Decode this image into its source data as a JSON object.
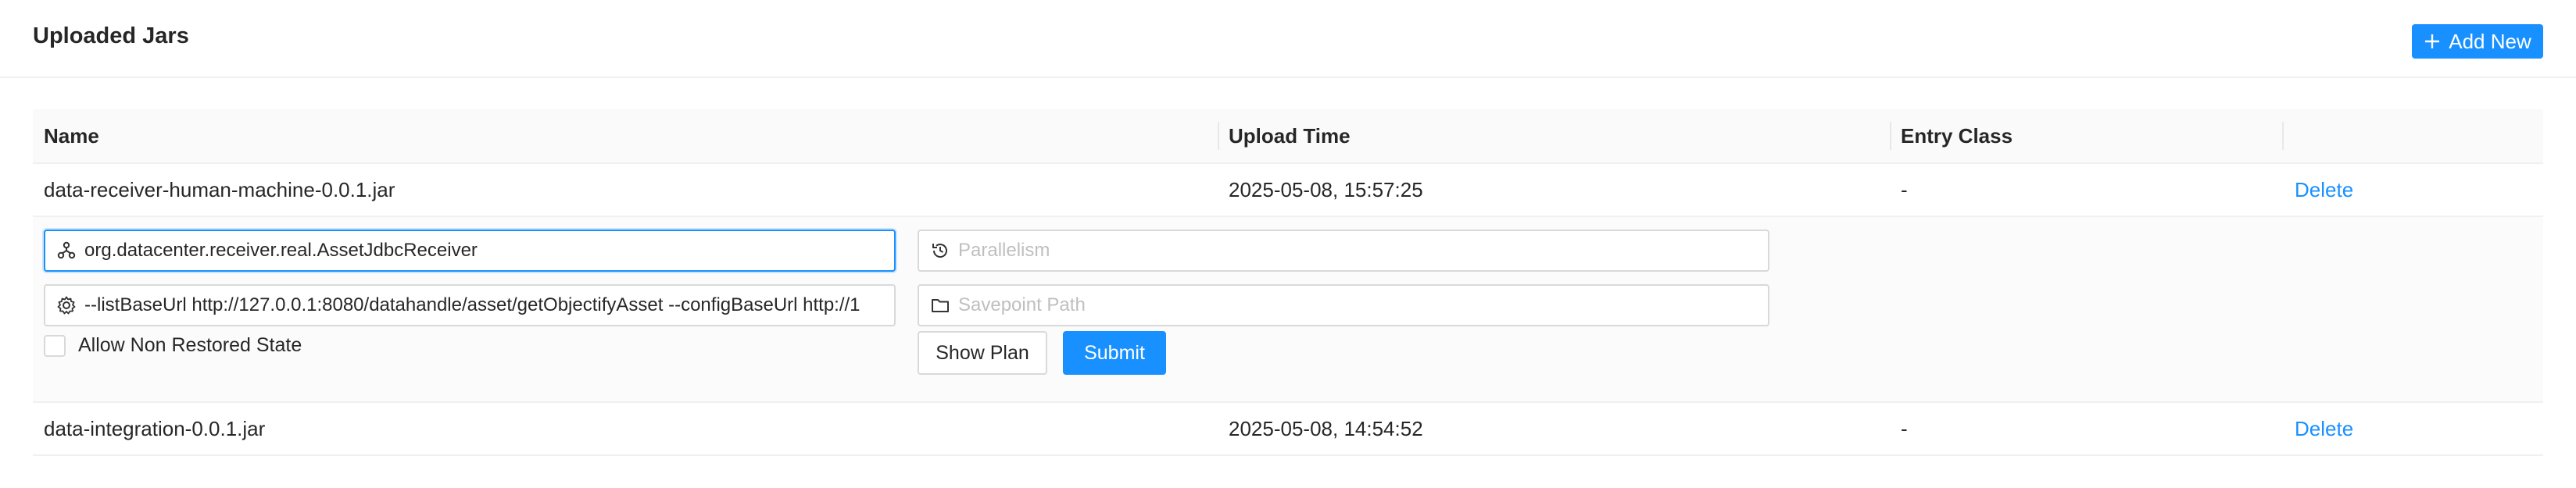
{
  "header": {
    "title": "Uploaded Jars",
    "add_label": "Add New"
  },
  "table": {
    "columns": [
      "Name",
      "Upload Time",
      "Entry Class",
      ""
    ],
    "rows": [
      {
        "name": "data-receiver-human-machine-0.0.1.jar",
        "upload_time": "2025-05-08, 15:57:25",
        "entry_class": "-",
        "action": "Delete"
      },
      {
        "name": "data-integration-0.0.1.jar",
        "upload_time": "2025-05-08, 14:54:52",
        "entry_class": "-",
        "action": "Delete"
      }
    ]
  },
  "submit_form": {
    "entry_class_value": "org.datacenter.receiver.real.AssetJdbcReceiver",
    "program_args_value": "--listBaseUrl http://127.0.0.1:8080/datahandle/asset/getObjectifyAsset --configBaseUrl http://1",
    "parallelism_placeholder": "Parallelism",
    "savepoint_placeholder": "Savepoint Path",
    "allow_non_restored_label": "Allow Non Restored State",
    "show_plan_label": "Show Plan",
    "submit_label": "Submit"
  },
  "colors": {
    "primary": "#1890ff",
    "header_bg": "#fafafa",
    "border": "#d9d9d9"
  },
  "icons": {
    "add": "plus-icon",
    "entry_class": "cluster-icon",
    "program_args": "gear-icon",
    "parallelism": "history-icon",
    "savepoint": "folder-icon"
  }
}
